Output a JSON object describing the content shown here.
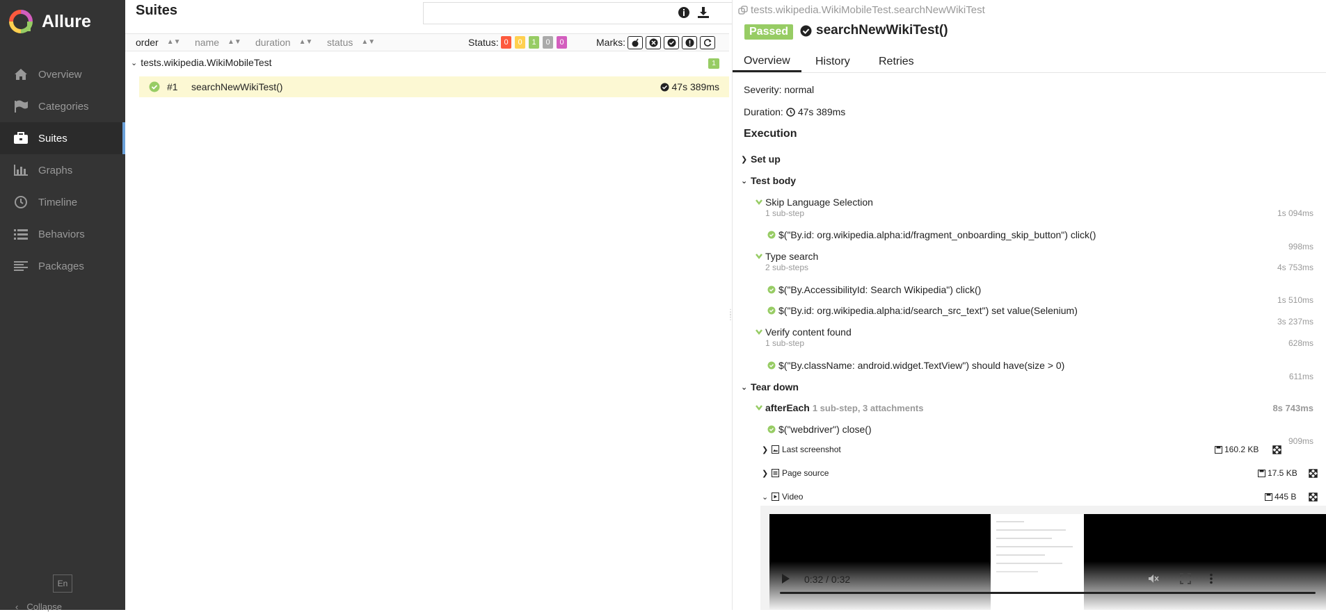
{
  "app": {
    "name": "Allure"
  },
  "sidebar": {
    "items": [
      {
        "label": "Overview",
        "icon": "home-icon"
      },
      {
        "label": "Categories",
        "icon": "flag-icon"
      },
      {
        "label": "Suites",
        "icon": "briefcase-icon"
      },
      {
        "label": "Graphs",
        "icon": "bar-chart-icon"
      },
      {
        "label": "Timeline",
        "icon": "clock-icon"
      },
      {
        "label": "Behaviors",
        "icon": "list-icon"
      },
      {
        "label": "Packages",
        "icon": "align-left-icon"
      }
    ],
    "active": "Suites",
    "language": "En",
    "collapse_label": "Collapse"
  },
  "suites": {
    "title": "Suites",
    "sort": {
      "order": "order",
      "name": "name",
      "duration": "duration",
      "status": "status"
    },
    "status_label": "Status:",
    "status_counts": [
      {
        "value": "0",
        "color": "#fd5a3e"
      },
      {
        "value": "0",
        "color": "#ffd050"
      },
      {
        "value": "1",
        "color": "#97cc64"
      },
      {
        "value": "0",
        "color": "#aaaaaa"
      },
      {
        "value": "0",
        "color": "#d35ebe"
      }
    ],
    "marks_label": "Marks:",
    "group": {
      "name": "tests.wikipedia.WikiMobileTest",
      "count": "1"
    },
    "test": {
      "number": "#1",
      "name": "searchNewWikiTest()",
      "duration": "47s 389ms"
    }
  },
  "detail": {
    "breadcrumb": "tests.wikipedia.WikiMobileTest.searchNewWikiTest",
    "status": "Passed",
    "status_color": "#97cc64",
    "title": "searchNewWikiTest()",
    "tabs": [
      "Overview",
      "History",
      "Retries"
    ],
    "severity": "Severity: normal",
    "duration_label": "Duration:",
    "duration": "47s 389ms",
    "execution_label": "Execution",
    "setup_label": "Set up",
    "test_body_label": "Test body",
    "steps": [
      {
        "name": "Skip Language Selection",
        "sub": "1 sub-step",
        "time": "1s 094ms"
      },
      {
        "name": "$(\"By.id: org.wikipedia.alpha:id/fragment_onboarding_skip_button\") click()",
        "time": "998ms"
      },
      {
        "name": "Type search",
        "sub": "2 sub-steps",
        "time": "4s 753ms"
      },
      {
        "name": "$(\"By.AccessibilityId: Search Wikipedia\") click()",
        "time": "1s 510ms"
      },
      {
        "name": "$(\"By.id: org.wikipedia.alpha:id/search_src_text\") set value(Selenium)",
        "time": "3s 237ms"
      },
      {
        "name": "Verify content found",
        "sub": "1 sub-step",
        "time": "628ms"
      },
      {
        "name": "$(\"By.className: android.widget.TextView\") should have(size > 0)",
        "time": "611ms"
      }
    ],
    "teardown_label": "Tear down",
    "after_each": {
      "name": "afterEach",
      "info": "1 sub-step, 3 attachments",
      "time": "8s 743ms"
    },
    "close_step": {
      "name": "$(\"webdriver\") close()",
      "time": "909ms"
    },
    "attachments": [
      {
        "name": "Last screenshot",
        "size": "160.2 KB"
      },
      {
        "name": "Page source",
        "size": "17.5 KB"
      },
      {
        "name": "Video",
        "size": "445 B"
      }
    ],
    "video": {
      "time": "0:32 / 0:32",
      "progress": 1.0
    }
  }
}
